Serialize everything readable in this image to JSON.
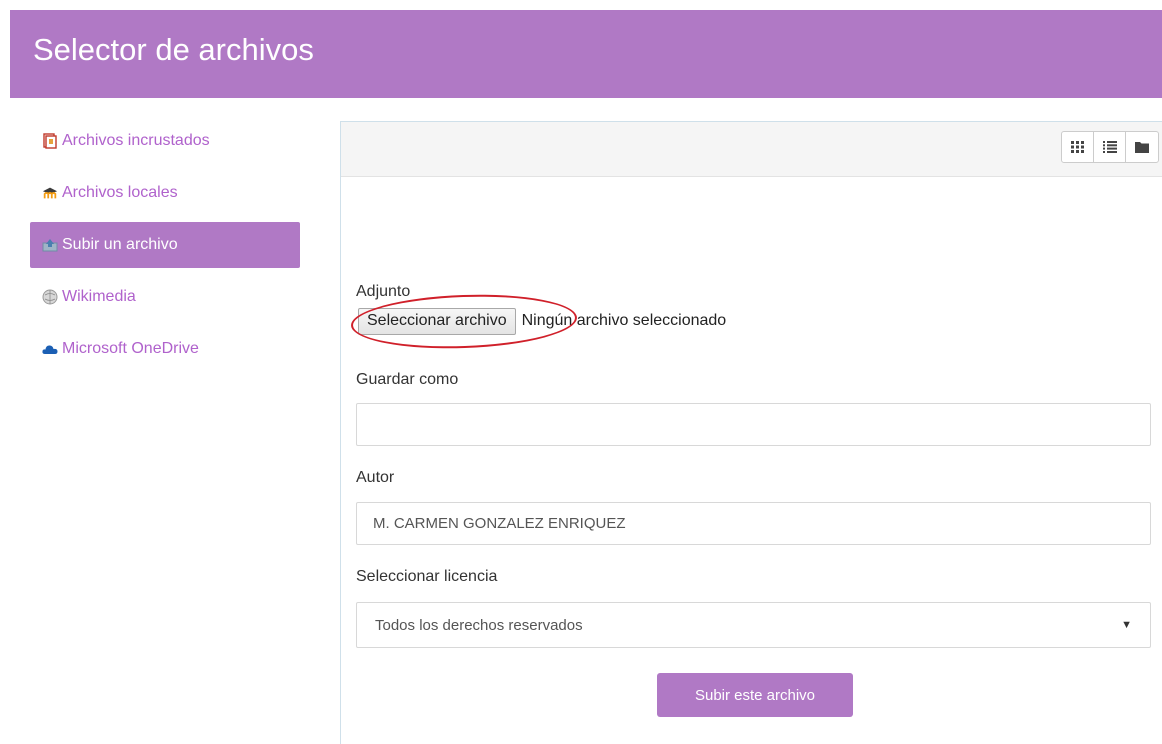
{
  "header": {
    "title": "Selector de archivos"
  },
  "sidebar": {
    "items": [
      {
        "label": "Archivos incrustados",
        "icon": "embedded-files-icon"
      },
      {
        "label": "Archivos locales",
        "icon": "moodle-icon"
      },
      {
        "label": "Subir un archivo",
        "icon": "upload-icon",
        "active": true
      },
      {
        "label": "Wikimedia",
        "icon": "wikimedia-icon"
      },
      {
        "label": "Microsoft OneDrive",
        "icon": "onedrive-icon"
      }
    ]
  },
  "toolbar": {
    "views": [
      "grid-view-icon",
      "list-view-icon",
      "folder-view-icon"
    ]
  },
  "form": {
    "attachment_label": "Adjunto",
    "file_button_label": "Seleccionar archivo",
    "file_status": "Ningún archivo seleccionado",
    "save_as_label": "Guardar como",
    "save_as_value": "",
    "author_label": "Autor",
    "author_value": "M. CARMEN GONZALEZ ENRIQUEZ",
    "license_label": "Seleccionar licencia",
    "license_value": "Todos los derechos reservados",
    "submit_label": "Subir este archivo"
  },
  "colors": {
    "brand": "#b079c5",
    "link": "#b062cc",
    "annotation": "#d0202a"
  }
}
